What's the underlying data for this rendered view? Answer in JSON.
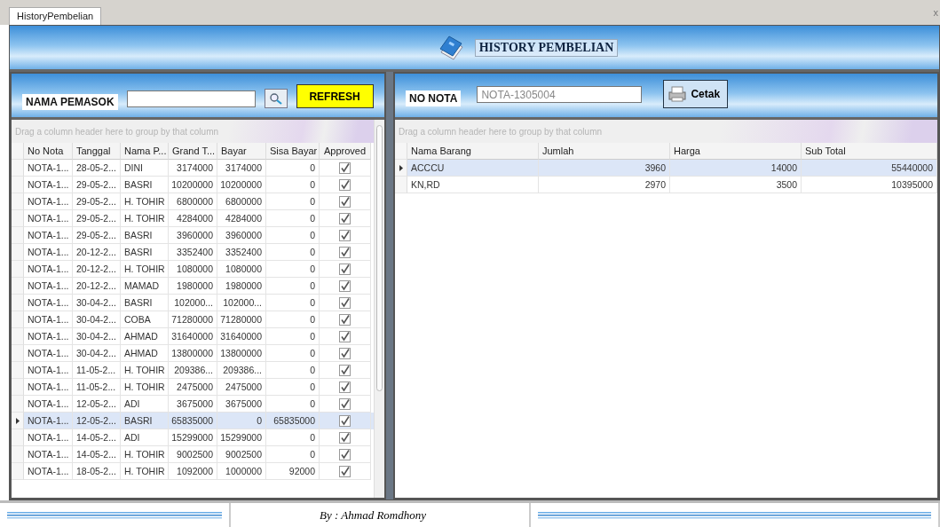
{
  "tab": {
    "label": "HistoryPembelian",
    "selected": true
  },
  "close": "x",
  "header": {
    "title": "HISTORY PEMBELIAN"
  },
  "left": {
    "search_label": "NAMA PEMASOK",
    "refresh": "REFRESH",
    "grid": {
      "group_hint": "Drag a column header here to group by that column",
      "columns": [
        {
          "label": "No Nota",
          "kind": "text"
        },
        {
          "label": "Tanggal",
          "kind": "text"
        },
        {
          "label": "Nama P...",
          "kind": "text"
        },
        {
          "label": "Grand T...",
          "kind": "number"
        },
        {
          "label": "Bayar",
          "kind": "number"
        },
        {
          "label": "Sisa Bayar",
          "kind": "number"
        },
        {
          "label": "Approved",
          "kind": "check"
        }
      ],
      "rows": [
        {
          "cells": [
            "NOTA-1...",
            "28-05-2...",
            "DINI",
            "3174000",
            "3174000",
            "0"
          ],
          "approved": true,
          "selected": false
        },
        {
          "cells": [
            "NOTA-1...",
            "29-05-2...",
            "BASRI",
            "10200000",
            "10200000",
            "0"
          ],
          "approved": true,
          "selected": false
        },
        {
          "cells": [
            "NOTA-1...",
            "29-05-2...",
            "H. TOHIR",
            "6800000",
            "6800000",
            "0"
          ],
          "approved": true,
          "selected": false
        },
        {
          "cells": [
            "NOTA-1...",
            "29-05-2...",
            "H. TOHIR",
            "4284000",
            "4284000",
            "0"
          ],
          "approved": true,
          "selected": false
        },
        {
          "cells": [
            "NOTA-1...",
            "29-05-2...",
            "BASRI",
            "3960000",
            "3960000",
            "0"
          ],
          "approved": true,
          "selected": false
        },
        {
          "cells": [
            "NOTA-1...",
            "20-12-2...",
            "BASRI",
            "3352400",
            "3352400",
            "0"
          ],
          "approved": true,
          "selected": false
        },
        {
          "cells": [
            "NOTA-1...",
            "20-12-2...",
            "H. TOHIR",
            "1080000",
            "1080000",
            "0"
          ],
          "approved": true,
          "selected": false
        },
        {
          "cells": [
            "NOTA-1...",
            "20-12-2...",
            "MAMAD",
            "1980000",
            "1980000",
            "0"
          ],
          "approved": true,
          "selected": false
        },
        {
          "cells": [
            "NOTA-1...",
            "30-04-2...",
            "BASRI",
            "102000...",
            "102000...",
            "0"
          ],
          "approved": true,
          "selected": false
        },
        {
          "cells": [
            "NOTA-1...",
            "30-04-2...",
            "COBA",
            "71280000",
            "71280000",
            "0"
          ],
          "approved": true,
          "selected": false
        },
        {
          "cells": [
            "NOTA-1...",
            "30-04-2...",
            "AHMAD",
            "31640000",
            "31640000",
            "0"
          ],
          "approved": true,
          "selected": false
        },
        {
          "cells": [
            "NOTA-1...",
            "30-04-2...",
            "AHMAD",
            "13800000",
            "13800000",
            "0"
          ],
          "approved": true,
          "selected": false
        },
        {
          "cells": [
            "NOTA-1...",
            "11-05-2...",
            "H. TOHIR",
            "209386...",
            "209386...",
            "0"
          ],
          "approved": true,
          "selected": false
        },
        {
          "cells": [
            "NOTA-1...",
            "11-05-2...",
            "H. TOHIR",
            "2475000",
            "2475000",
            "0"
          ],
          "approved": true,
          "selected": false
        },
        {
          "cells": [
            "NOTA-1...",
            "12-05-2...",
            "ADI",
            "3675000",
            "3675000",
            "0"
          ],
          "approved": true,
          "selected": false
        },
        {
          "cells": [
            "NOTA-1...",
            "12-05-2...",
            "BASRI",
            "65835000",
            "0",
            "65835000"
          ],
          "approved": true,
          "selected": true
        },
        {
          "cells": [
            "NOTA-1...",
            "14-05-2...",
            "ADI",
            "15299000",
            "15299000",
            "0"
          ],
          "approved": true,
          "selected": false
        },
        {
          "cells": [
            "NOTA-1...",
            "14-05-2...",
            "H. TOHIR",
            "9002500",
            "9002500",
            "0"
          ],
          "approved": true,
          "selected": false
        },
        {
          "cells": [
            "NOTA-1...",
            "18-05-2...",
            "H. TOHIR",
            "1092000",
            "1000000",
            "92000"
          ],
          "approved": true,
          "selected": false
        }
      ]
    }
  },
  "right": {
    "nota_label": "NO NOTA",
    "nota_value": "NOTA-1305004",
    "print": "Cetak",
    "grid": {
      "group_hint": "Drag a column header here to group by that column",
      "columns": [
        {
          "label": "Nama Barang",
          "kind": "text"
        },
        {
          "label": "Jumlah",
          "kind": "number"
        },
        {
          "label": "Harga",
          "kind": "number"
        },
        {
          "label": "Sub Total",
          "kind": "number"
        }
      ],
      "rows": [
        {
          "cells": [
            "ACCCU",
            "3960",
            "14000",
            "55440000"
          ],
          "selected": true
        },
        {
          "cells": [
            "KN,RD",
            "2970",
            "3500",
            "10395000"
          ],
          "selected": false
        }
      ]
    }
  },
  "footer": {
    "credit": "By : Ahmad Romdhony"
  }
}
